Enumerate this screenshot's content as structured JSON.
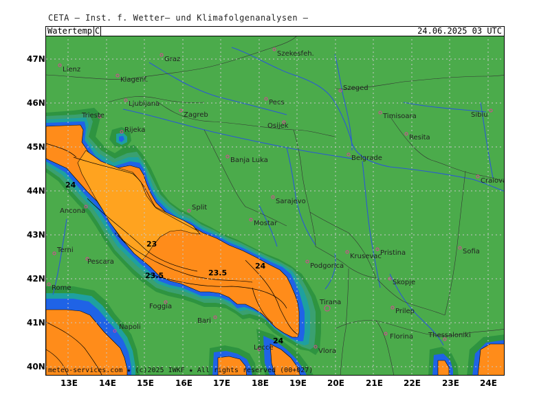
{
  "header": {
    "title": "CETA — Inst. f. Wetter— und Klimafolgenanalysen —",
    "variable": "Watertemp",
    "unit": "C",
    "timestamp": "24.06.2025 03 UTC"
  },
  "footer": {
    "credit": "meteo-services.com ★ (c)2025 IWKF ★ All rights reserved (00+027)"
  },
  "axes": {
    "lon_labels": [
      "13E",
      "14E",
      "15E",
      "16E",
      "17E",
      "18E",
      "19E",
      "20E",
      "21E",
      "22E",
      "23E",
      "24E"
    ],
    "lat_labels": [
      "47N",
      "46N",
      "45N",
      "44N",
      "43N",
      "42N",
      "41N",
      "40N"
    ]
  },
  "colors": {
    "land": "#4bab4b",
    "coast_dark": "#2e9440",
    "coast_mid": "#3aa070",
    "teal": "#1ea0a0",
    "blue": "#1f63e6",
    "light_blue": "#3e8ee8",
    "orange": "#ff8c1a",
    "orange_light": "#ffa31f",
    "river": "#2a58d6",
    "border": "#333333",
    "grid": "#bfbfbf",
    "city": "#e0409a"
  },
  "cities": [
    {
      "name": "Lienz"
    },
    {
      "name": "Graz"
    },
    {
      "name": "Szekesfeh."
    },
    {
      "name": "Klagenf."
    },
    {
      "name": "Szeged"
    },
    {
      "name": "Ljubljana"
    },
    {
      "name": "Zagreb"
    },
    {
      "name": "Pecs"
    },
    {
      "name": "Timisoara"
    },
    {
      "name": "Sibiu"
    },
    {
      "name": "Trieste"
    },
    {
      "name": "Osijek"
    },
    {
      "name": "Rijeka"
    },
    {
      "name": "Resita"
    },
    {
      "name": "Banja Luka"
    },
    {
      "name": "Belgrade"
    },
    {
      "name": "Craiova"
    },
    {
      "name": "Sarajevo"
    },
    {
      "name": "Split"
    },
    {
      "name": "Ancona"
    },
    {
      "name": "Mostar"
    },
    {
      "name": "Terni"
    },
    {
      "name": "Pescara"
    },
    {
      "name": "Podgorica"
    },
    {
      "name": "Krusevac"
    },
    {
      "name": "Pristina"
    },
    {
      "name": "Sofia"
    },
    {
      "name": "Skopje"
    },
    {
      "name": "Rome"
    },
    {
      "name": "Foggia"
    },
    {
      "name": "Tirana"
    },
    {
      "name": "Prilep"
    },
    {
      "name": "Bari"
    },
    {
      "name": "Napoli"
    },
    {
      "name": "Florina"
    },
    {
      "name": "Thessaloniki"
    },
    {
      "name": "Vlora"
    },
    {
      "name": "Lecce"
    }
  ],
  "contour_labels": [
    "24",
    "23",
    "23.5",
    "23.5",
    "24",
    "24"
  ]
}
